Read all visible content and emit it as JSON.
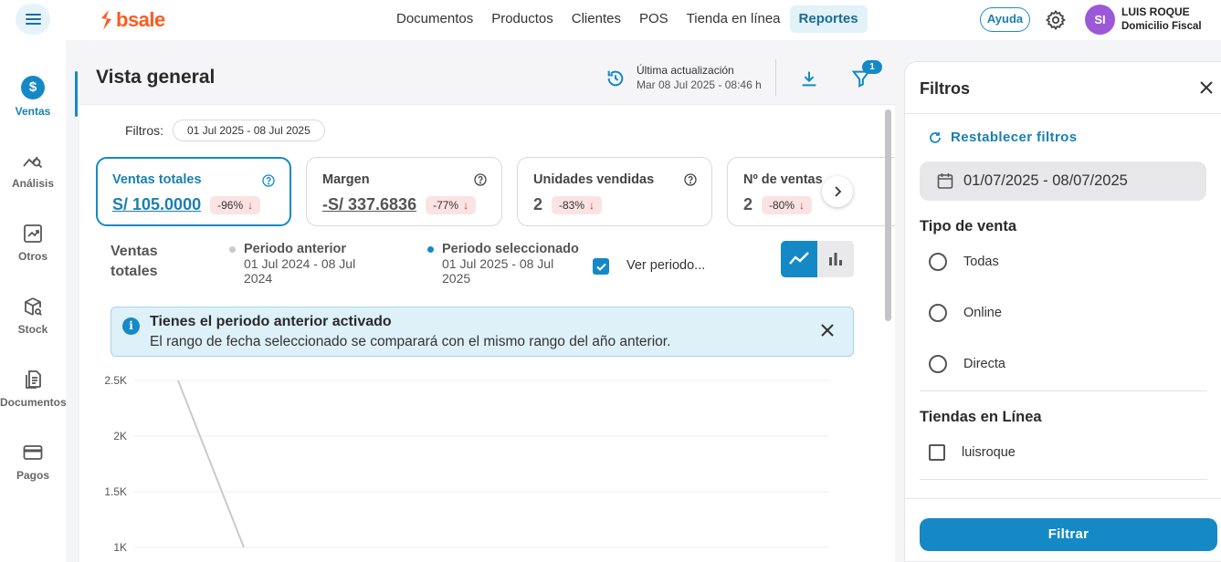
{
  "brand": {
    "name": "bsale",
    "color": "#ff5a1f"
  },
  "topnav": {
    "items": [
      {
        "label": "Documentos"
      },
      {
        "label": "Productos"
      },
      {
        "label": "Clientes"
      },
      {
        "label": "POS"
      },
      {
        "label": "Tienda en línea"
      },
      {
        "label": "Reportes",
        "active": true
      }
    ],
    "help_label": "Ayuda"
  },
  "user": {
    "initials": "SI",
    "name": "LUIS ROQUE",
    "role": "Domicilio Fiscal"
  },
  "sidebar": {
    "items": [
      {
        "label": "Ventas",
        "icon": "dollar-circle-icon",
        "active": true
      },
      {
        "label": "Análisis",
        "icon": "analytics-icon"
      },
      {
        "label": "Otros",
        "icon": "trend-chart-icon"
      },
      {
        "label": "Stock",
        "icon": "box-search-icon"
      },
      {
        "label": "Documentos",
        "icon": "documents-icon"
      },
      {
        "label": "Pagos",
        "icon": "card-icon"
      }
    ]
  },
  "main": {
    "title": "Vista general",
    "update_label": "Última actualización",
    "update_value": "Mar 08 Jul 2025 - 08:46 h",
    "filter_badge": "1",
    "filters_label": "Filtros:",
    "date_range_chip": "01 Jul 2025 - 08 Jul 2025",
    "kpis": [
      {
        "title": "Ventas totales",
        "value": "S/ 105.0000",
        "delta": "-96%",
        "active": true
      },
      {
        "title": "Margen",
        "value": "-S/ 337.6836",
        "delta": "-77%"
      },
      {
        "title": "Unidades vendidas",
        "value": "2",
        "delta": "-83%"
      },
      {
        "title": "Nº de ventas",
        "value": "2",
        "delta": "-80%"
      }
    ],
    "chart_title": "Ventas totales",
    "legend_prev_title": "Periodo anterior",
    "legend_prev_range": "01 Jul 2024 - 08 Jul 2024",
    "legend_sel_title": "Periodo seleccionado",
    "legend_sel_range": "01 Jul 2025 - 08 Jul 2025",
    "compare_label": "Ver periodo...",
    "compare_checked": true,
    "alert_title": "Tienes el periodo anterior activado",
    "alert_text": "El rango de fecha seleccionado se comparará con el mismo rango del año anterior."
  },
  "chart_data": {
    "type": "line",
    "title": "Ventas totales",
    "y_ticks": [
      "2.5K",
      "2K",
      "1.5K",
      "1K"
    ],
    "ylim": [
      1000,
      2500
    ],
    "series": [
      {
        "name": "Periodo anterior",
        "color": "#c9c9cf",
        "x": [
          0,
          1
        ],
        "values": [
          2500,
          1000
        ]
      }
    ],
    "grid": true
  },
  "filter_panel": {
    "title": "Filtros",
    "reset_label": "Restablecer filtros",
    "date_value": "01/07/2025 - 08/07/2025",
    "sale_type_title": "Tipo de venta",
    "sale_types": [
      "Todas",
      "Online",
      "Directa"
    ],
    "stores_title": "Tiendas en Línea",
    "stores": [
      "luisroque"
    ],
    "apply_label": "Filtrar"
  },
  "colors": {
    "accent": "#1589c6",
    "delta_bg": "#fbe3e4",
    "delta_arrow": "#c9302c"
  }
}
